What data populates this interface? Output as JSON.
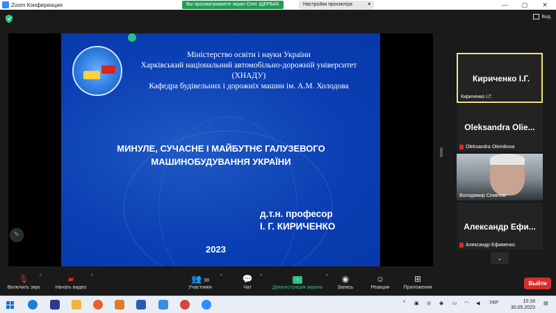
{
  "titlebar": {
    "app_title": "Zoom Конференция",
    "sharing_notice": "Вы просматриваете экран Олег ЩЕРБАК",
    "view_options": "Настройки просмотра",
    "view_options_caret": "▾",
    "minimize": "—",
    "maximize": "▢",
    "close": "✕"
  },
  "topstrip": {
    "view_label": "Вид"
  },
  "slide": {
    "header_lines": [
      "Міністерство освіти і науки України",
      "Харківський національний автомобільно-дорожній університет",
      "(ХНАДУ)",
      "Кафедра будівельних і дорожніх машин ім. А.М. Холодова"
    ],
    "title_lines": [
      "МИНУЛЕ, СУЧАСНЕ І МАЙБУТНЄ ГАЛУЗЕВОГО",
      "МАШИНОБУДУВАННЯ УКРАЇНИ"
    ],
    "author_lines": [
      "д.т.н. професор",
      "І. Г. КИРИЧЕНКО"
    ],
    "year": "2023"
  },
  "participants": [
    {
      "display": "Кириченко І.Г.",
      "label": "Кириченко І.Г.",
      "muted": false,
      "active": true
    },
    {
      "display": "Oleksandra  Olie...",
      "label": "Oleksandra Oleinikova",
      "muted": true
    },
    {
      "display": "",
      "label": "Володимир Семенок",
      "muted": false
    },
    {
      "display": "Александр  Ефи...",
      "label": "Александр Ефименко",
      "muted": true
    }
  ],
  "toolbar": {
    "unmute_label": "Включить звук",
    "start_video_label": "Начать видео",
    "participants_label": "Участники",
    "participants_count": "38",
    "chat_label": "Чат",
    "share_label": "Демонстрация экрана",
    "record_label": "Запись",
    "reactions_label": "Реакции",
    "apps_label": "Приложения",
    "leave_label": "Выйти"
  },
  "taskbar": {
    "language": "УКР",
    "time": "10:18",
    "date": "30.05.2023",
    "tray_arrow": "^"
  },
  "colors": {
    "slide_blue": "#0a3eb3",
    "share_green": "#1f9d55",
    "leave_red": "#d72e2e",
    "active_speaker_border": "#f2e57a"
  }
}
